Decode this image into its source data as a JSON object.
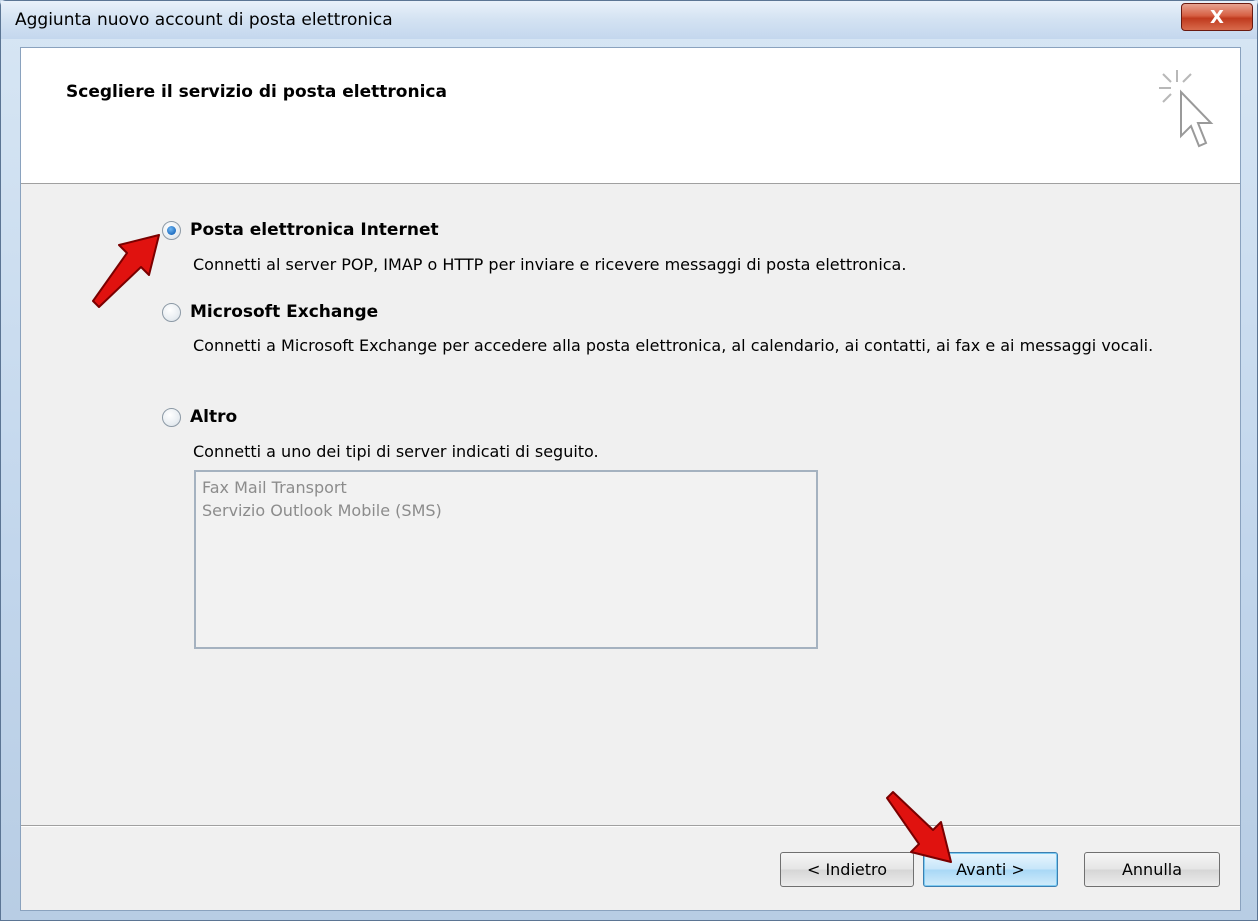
{
  "window": {
    "title": "Aggiunta nuovo account di posta elettronica",
    "close_glyph": "X"
  },
  "header": {
    "title": "Scegliere il servizio di posta elettronica",
    "icon": "wizard-cursor-icon"
  },
  "options": [
    {
      "label": "Posta elettronica Internet",
      "description": "Connetti al server POP, IMAP o HTTP per inviare e ricevere messaggi di posta elettronica.",
      "checked": true
    },
    {
      "label": "Microsoft Exchange",
      "description": "Connetti a Microsoft Exchange per accedere alla posta elettronica, al calendario, ai contatti, ai fax e ai messaggi vocali.",
      "checked": false
    },
    {
      "label": "Altro",
      "description": "Connetti a uno dei tipi di server indicati di seguito.",
      "checked": false
    }
  ],
  "other_servers": {
    "items": [
      "Fax Mail Transport",
      "Servizio Outlook Mobile (SMS)"
    ],
    "disabled": true
  },
  "buttons": {
    "back": "< Indietro",
    "next": "Avanti >",
    "cancel": "Annulla"
  },
  "colors": {
    "annotation_arrow": "#e0120f",
    "radio_selected": "#1f6fc2"
  }
}
